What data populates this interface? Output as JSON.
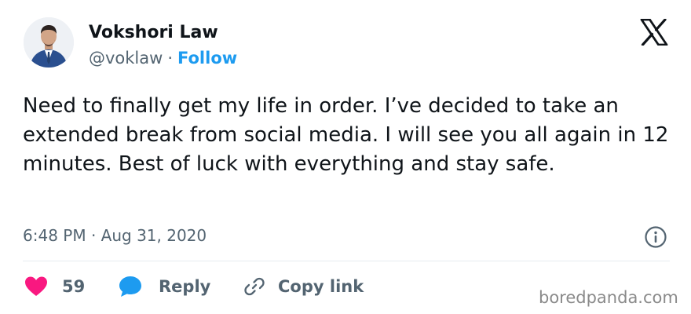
{
  "author": {
    "name": "Vokshori Law",
    "handle": "@voklaw",
    "separator": "·",
    "follow_label": "Follow"
  },
  "tweet": {
    "text": "Need to finally get my life in order. I’ve decided to take an extended break from social media. I will see you all again in 12 minutes. Best of luck with everything and stay safe.",
    "timestamp": "6:48 PM · Aug 31, 2020"
  },
  "actions": {
    "like_count": "59",
    "reply_label": "Reply",
    "copy_link_label": "Copy link"
  },
  "watermark": "boredpanda.com",
  "icons": {
    "logo": "x-logo-icon",
    "info": "info-icon",
    "like": "heart-icon",
    "reply": "speech-bubble-icon",
    "copy": "link-icon"
  },
  "colors": {
    "accent": "#1d9bf0",
    "like": "#f91880",
    "text": "#0f1419",
    "muted": "#536471"
  }
}
